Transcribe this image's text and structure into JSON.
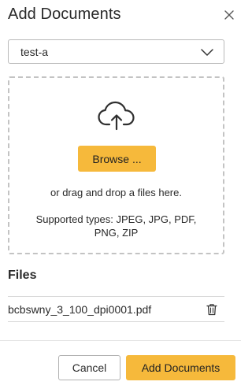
{
  "dialog": {
    "title": "Add Documents"
  },
  "collection_select": {
    "selected": "test-a"
  },
  "dropzone": {
    "browse_label": "Browse ...",
    "drag_text": "or drag and drop a files here.",
    "supported_types": "Supported types: JPEG, JPG, PDF, PNG, ZIP"
  },
  "files": {
    "heading": "Files",
    "items": [
      {
        "name": "bcbswny_3_100_dpi0001.pdf"
      }
    ]
  },
  "footer": {
    "cancel_label": "Cancel",
    "add_label": "Add Documents"
  },
  "colors": {
    "accent": "#f6b93b",
    "border": "#b9b9b9",
    "dashed_border": "#c3c3c3",
    "text": "#2a2a2a"
  },
  "icons": [
    "close-icon",
    "chevron-down-icon",
    "cloud-upload-icon",
    "trash-icon"
  ]
}
